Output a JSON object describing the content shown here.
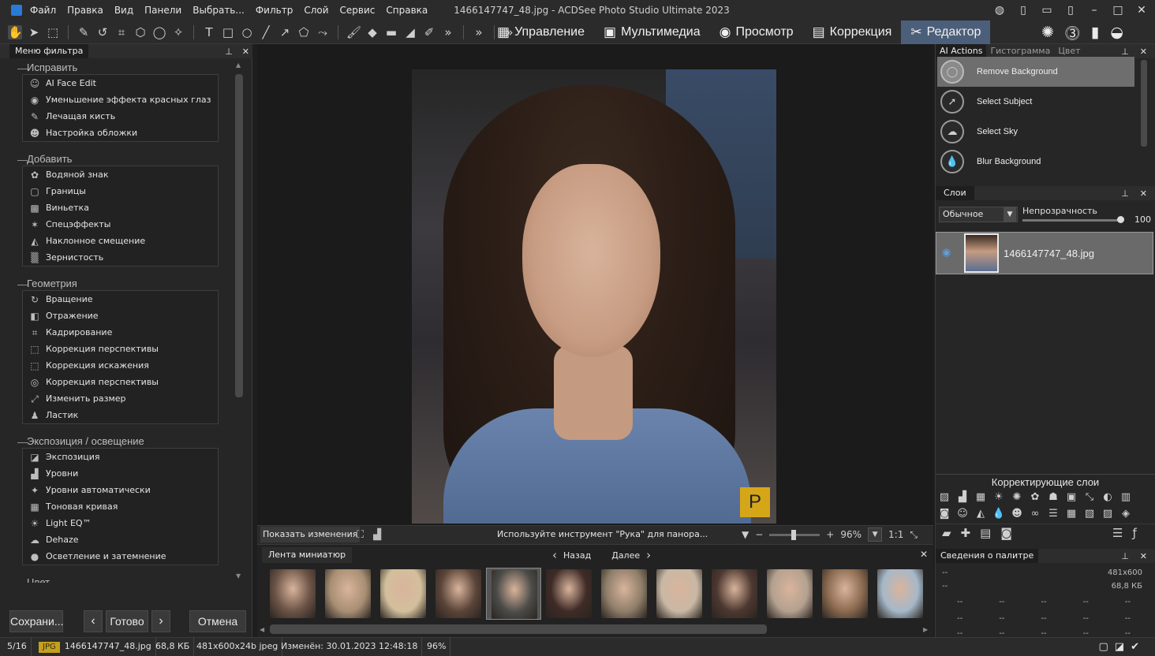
{
  "window": {
    "title": "1466147747_48.jpg - ACDSee Photo Studio Ultimate 2023",
    "menu": [
      "Файл",
      "Правка",
      "Вид",
      "Панели",
      "Выбрать...",
      "Фильтр",
      "Слой",
      "Сервис",
      "Справка"
    ]
  },
  "modes": [
    {
      "label": "Управление",
      "icon": "grid-icon",
      "glyph": "▦",
      "active": false
    },
    {
      "label": "Мультимедиа",
      "icon": "media-icon",
      "glyph": "▣",
      "active": false
    },
    {
      "label": "Просмотр",
      "icon": "eye-icon",
      "glyph": "◉",
      "active": false
    },
    {
      "label": "Коррекция",
      "icon": "develop-icon",
      "glyph": "▤",
      "active": false
    },
    {
      "label": "Редактор",
      "icon": "edit-icon",
      "glyph": "✂",
      "active": true
    }
  ],
  "left_panel": {
    "tab": "Меню фильтра",
    "categories": [
      {
        "name": "Исправить",
        "items": [
          {
            "label": "AI Face Edit",
            "icon": "face-icon",
            "glyph": "☺"
          },
          {
            "label": "Уменьшение эффекта красных глаз",
            "icon": "red-eye-icon",
            "glyph": "◉"
          },
          {
            "label": "Лечащая кисть",
            "icon": "healing-brush-icon",
            "glyph": "✎"
          },
          {
            "label": "Настройка обложки",
            "icon": "skin-tune-icon",
            "glyph": "☻"
          }
        ]
      },
      {
        "name": "Добавить",
        "items": [
          {
            "label": "Водяной знак",
            "icon": "watermark-icon",
            "glyph": "✿"
          },
          {
            "label": "Границы",
            "icon": "borders-icon",
            "glyph": "▢"
          },
          {
            "label": "Виньетка",
            "icon": "vignette-icon",
            "glyph": "▩"
          },
          {
            "label": "Спецэффекты",
            "icon": "effects-icon",
            "glyph": "✶"
          },
          {
            "label": "Наклонное смещение",
            "icon": "tilt-shift-icon",
            "glyph": "◭"
          },
          {
            "label": "Зернистость",
            "icon": "grain-icon",
            "glyph": "▒"
          }
        ]
      },
      {
        "name": "Геометрия",
        "items": [
          {
            "label": "Вращение",
            "icon": "rotate-icon",
            "glyph": "↻"
          },
          {
            "label": "Отражение",
            "icon": "flip-icon",
            "glyph": "◧"
          },
          {
            "label": "Кадрирование",
            "icon": "crop-icon",
            "glyph": "⌗"
          },
          {
            "label": "Коррекция перспективы",
            "icon": "perspective-icon",
            "glyph": "⬚"
          },
          {
            "label": "Коррекция искажения",
            "icon": "distortion-icon",
            "glyph": "⬚"
          },
          {
            "label": "Коррекция перспективы",
            "icon": "lens-icon",
            "glyph": "◎"
          },
          {
            "label": "Изменить размер",
            "icon": "resize-icon",
            "glyph": "⤢"
          },
          {
            "label": "Ластик",
            "icon": "eraser-icon",
            "glyph": "♟"
          }
        ]
      },
      {
        "name": "Экспозиция / освещение",
        "items": [
          {
            "label": "Экспозиция",
            "icon": "exposure-icon",
            "glyph": "◪"
          },
          {
            "label": "Уровни",
            "icon": "levels-icon",
            "glyph": "▟"
          },
          {
            "label": "Уровни автоматически",
            "icon": "auto-levels-icon",
            "glyph": "✦"
          },
          {
            "label": "Тоновая кривая",
            "icon": "curve-icon",
            "glyph": "▦"
          },
          {
            "label": "Light EQ™",
            "icon": "light-eq-icon",
            "glyph": "☀"
          },
          {
            "label": "Dehaze",
            "icon": "dehaze-icon",
            "glyph": "☁"
          },
          {
            "label": "Осветление и затемнение",
            "icon": "dodge-burn-icon",
            "glyph": "●"
          }
        ]
      }
    ],
    "next_category": "Цвет",
    "buttons": {
      "save": "Сохрани...",
      "done": "Готово",
      "cancel": "Отмена"
    }
  },
  "canvas": {
    "show_changes": "Показать изменения",
    "hint": "Используйте инструмент \"Рука\" для панора...",
    "zoom": "96%",
    "ratio": "1:1",
    "badge": "P"
  },
  "filmstrip": {
    "tab": "Лента миниатюр",
    "back": "Назад",
    "next": "Далее",
    "thumb_colors": [
      "#6b5346",
      "#a88f74",
      "#d3bf9c",
      "#5b4438",
      "#4b4b48",
      "#3f2b27",
      "#8f7e6a",
      "#c9b8a4",
      "#4d3830",
      "#b4a18f",
      "#8a6a50",
      "#a6b8c9"
    ],
    "selected_index": 4
  },
  "right_panel": {
    "tabs": [
      "AI Actions",
      "Гистограмма",
      "Цвет"
    ],
    "ai_actions": [
      {
        "label": "Remove Background",
        "icon": "remove-bg-icon",
        "glyph": "◯",
        "active": true
      },
      {
        "label": "Select Subject",
        "icon": "select-subject-icon",
        "glyph": "➚",
        "active": false
      },
      {
        "label": "Select Sky",
        "icon": "select-sky-icon",
        "glyph": "☁",
        "active": false
      },
      {
        "label": "Blur Background",
        "icon": "blur-bg-icon",
        "glyph": "💧",
        "active": false
      }
    ],
    "layers_tab": "Слои",
    "blend_mode": "Обычное",
    "opacity_label": "Непрозрачность",
    "opacity_value": "100",
    "layer_name": "1466147747_48.jpg",
    "adjust_title": "Корректирующие слои",
    "adjust_icons_row1": [
      "▨",
      "▟",
      "▦",
      "☀",
      "✺",
      "✿",
      "☗",
      "▣",
      "⤡",
      "◐",
      "▥"
    ],
    "adjust_icons_row2": [
      "◙",
      "☺",
      "◭",
      "💧",
      "☻",
      "∞",
      "☰",
      "▦",
      "▧",
      "▨",
      "◈"
    ],
    "palette_tab": "Сведения о палитре",
    "palette": {
      "size": "481x600",
      "filesize": "68,8 КБ",
      "dash": "--"
    }
  },
  "statusbar": {
    "index": "5/16",
    "format": "JPG",
    "filename": "1466147747_48.jpg",
    "filesize": "68,8 КБ",
    "dims": "481x600x24b jpeg",
    "modified": "Изменён: 30.01.2023 12:48:18",
    "zoom": "96%"
  }
}
